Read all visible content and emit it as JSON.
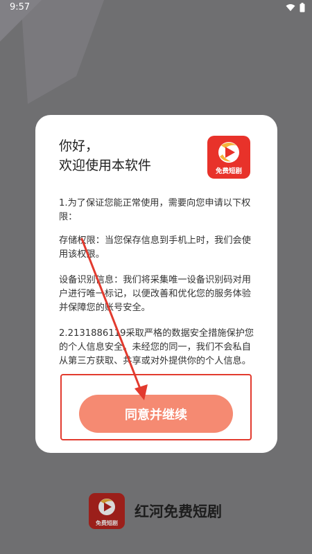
{
  "status_bar": {
    "time": "9:57",
    "icons": [
      "wifi-icon",
      "battery-icon"
    ]
  },
  "dialog": {
    "greeting_line1": "你好，",
    "greeting_line2": "欢迎使用本软件",
    "logo_badge": "免费短剧",
    "para1_line1": "1.为了保证您能正常使用，需要向您申请以下权",
    "para1_line2": "限：",
    "para2_line1": "存储权限：当您保存信息到手机上时，我们会使",
    "para2_line2": "用该权限。",
    "para3_line1": "设备识别信息：我们将采集唯一设备识别码对用",
    "para3_line2": "户进行唯一标记，以便改善和优化您的服务体验",
    "para3_line3": "并保障您的账号安全。",
    "para4_line1": "2.2131886119采取严格的数据安全措施保护您",
    "para4_line2": "的个人信息安全。未经您的同一，我们不会私自",
    "para4_line3": "从第三方获取、共享或对外提供你的个人信息。",
    "agree_button": "同意并继续"
  },
  "bottom": {
    "logo_badge": "免费短剧",
    "app_name": "红河免费短剧"
  },
  "colors": {
    "accent": "#e8322a",
    "button": "#f58a72",
    "overlay": "#6f6f71",
    "annotation": "#e23a2e"
  }
}
